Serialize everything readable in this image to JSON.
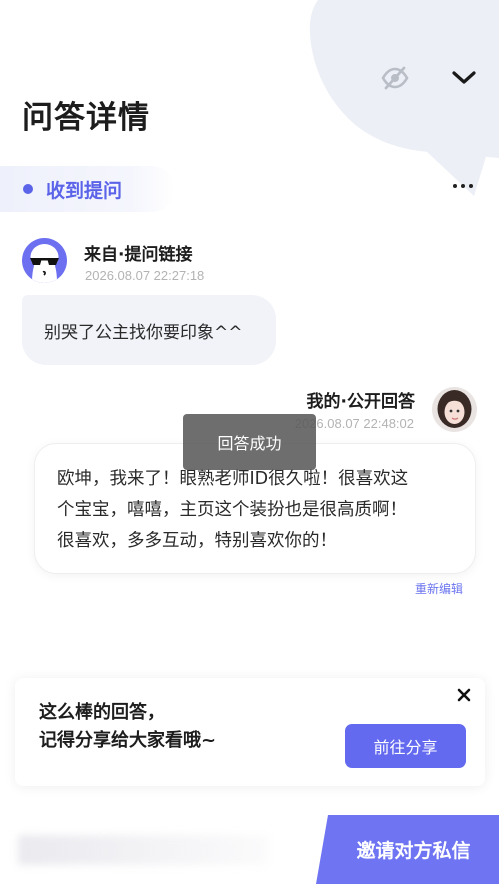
{
  "header": {
    "title": "问答详情",
    "icons": [
      "eye-slash-icon",
      "chevron-down-icon"
    ]
  },
  "section": {
    "tab_label": "收到提问",
    "more_icon": "more-horizontal-icon"
  },
  "question": {
    "from": "来自·提问链接",
    "time": "2026.08.07 22:27:18",
    "text": "别哭了公主找你要印象^^"
  },
  "answer": {
    "from": "我的·公开回答",
    "time": "2026.08.07 22:48:02",
    "lines": [
      "欧坤，我来了！眼熟老师ID很久啦！很喜欢这",
      "个宝宝，嘻嘻，主页这个装扮也是很高质啊！",
      "很喜欢，多多互动，特别喜欢你的！"
    ],
    "edit_label": "重新编辑"
  },
  "toast": {
    "text": "回答成功"
  },
  "share": {
    "line1": "这么棒的回答，",
    "line2": "记得分享给大家看哦~",
    "button_label": "前往分享"
  },
  "footer": {
    "invite_label": "邀请对方私信"
  },
  "colors": {
    "accent": "#5b63e8",
    "button": "#636af0",
    "invite": "#6f75f2",
    "bubble_bg": "#f1f3f9",
    "deco": "#eceff5"
  }
}
